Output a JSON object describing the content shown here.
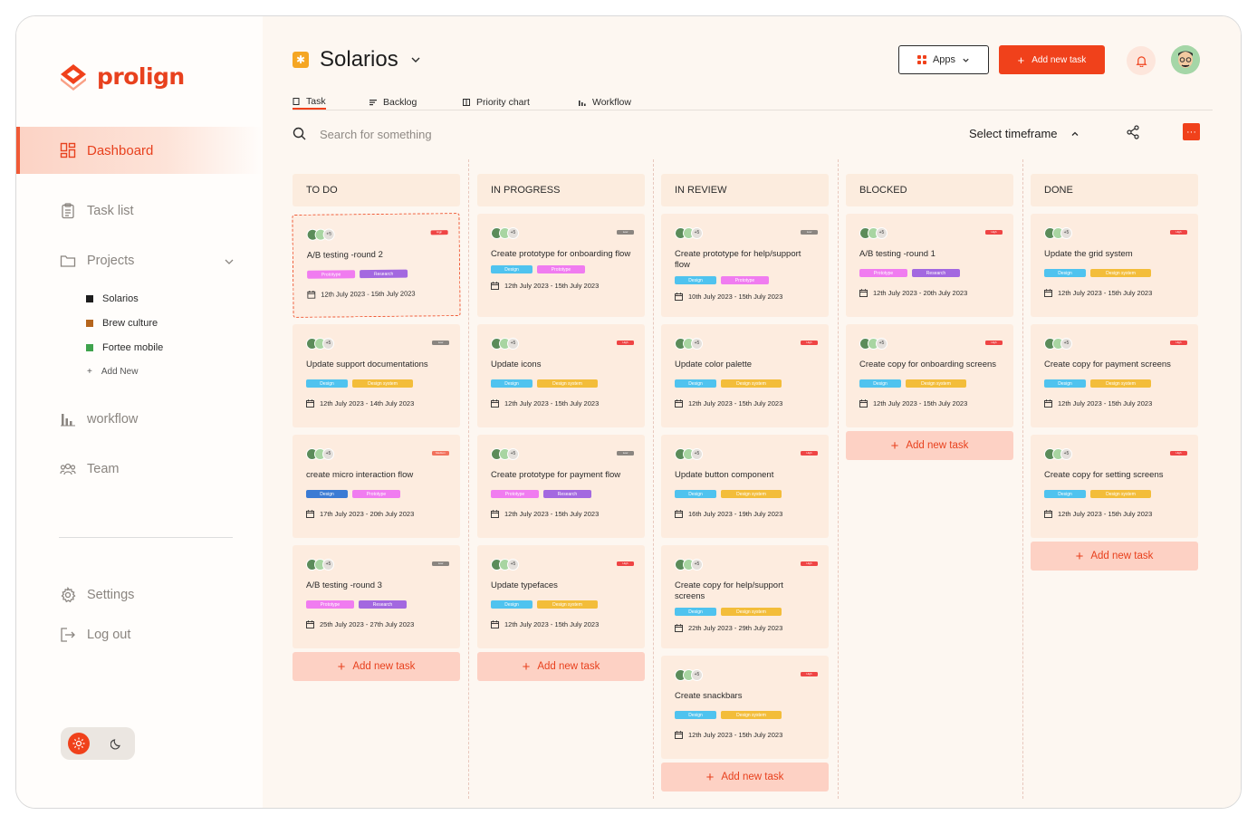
{
  "brand": {
    "name": "prolign",
    "accent": "#F0411B"
  },
  "sidebar": {
    "active_label": "Dashboard",
    "items": [
      {
        "label": "Task list",
        "icon": "clipboard-icon"
      },
      {
        "label": "Projects",
        "icon": "folder-icon"
      },
      {
        "label": "workflow",
        "icon": "bar-chart-icon"
      },
      {
        "label": "Team",
        "icon": "team-icon"
      },
      {
        "label": "Settings",
        "icon": "gear-icon"
      },
      {
        "label": "Log out",
        "icon": "logout-icon"
      }
    ],
    "projects": [
      {
        "name": "Solarios",
        "color": "#1d1d1d"
      },
      {
        "name": "Brew culture",
        "color": "#b5651d"
      },
      {
        "name": "Fortee mobile",
        "color": "#3fa34d"
      }
    ],
    "add_new": "Add New"
  },
  "header": {
    "project": "Solarios",
    "apps_label": "Apps",
    "add_label": "Add new task"
  },
  "tabs": [
    "Task",
    "Backlog",
    "Priority chart",
    "Workflow"
  ],
  "search": {
    "placeholder": "Search for something",
    "timeframe": "Select timeframe",
    "more": "···"
  },
  "add_task_label": "Add new task",
  "avatar_more": "+5",
  "columns": [
    {
      "title": "TO DO",
      "cards": [
        {
          "title": "A/B testing -round 2",
          "priority": "High",
          "tags": [
            "Prototype",
            "Research"
          ],
          "date": "12th July  2023 - 15th July 2023",
          "dragging": true
        },
        {
          "title": "Update support documentations",
          "priority": "Low",
          "tags": [
            "Design",
            "Design system"
          ],
          "date": "12th July  2023 - 14th July 2023"
        },
        {
          "title": "create micro interaction flow",
          "priority": "Medium",
          "tags": [
            "Design",
            "Prototype"
          ],
          "date": "17th July  2023 - 20th July 2023"
        },
        {
          "title": "A/B testing -round 3",
          "priority": "Low",
          "tags": [
            "Prototype",
            "Research"
          ],
          "date": "25th July  2023 - 27th July 2023"
        }
      ]
    },
    {
      "title": "IN PROGRESS",
      "cards": [
        {
          "title": "Create prototype for onboarding flow",
          "priority": "Low",
          "tags": [
            "Design",
            "Prototype"
          ],
          "date": "12th July  2023 - 15th July 2023"
        },
        {
          "title": "Update icons",
          "priority": "High",
          "tags": [
            "Design",
            "Design system"
          ],
          "date": "12th July  2023 - 15th July 2023"
        },
        {
          "title": "Create prototype for payment flow",
          "priority": "Low",
          "tags": [
            "Prototype",
            "Research"
          ],
          "date": "12th July  2023 - 15th July 2023"
        },
        {
          "title": "Update typefaces",
          "priority": "High",
          "tags": [
            "Design",
            "Design system"
          ],
          "date": "12th July  2023 - 15th July 2023"
        }
      ]
    },
    {
      "title": "IN REVIEW",
      "cards": [
        {
          "title": "Create prototype for help/support flow",
          "priority": "Low",
          "tags": [
            "Design",
            "Prototype"
          ],
          "date": "10th July  2023 - 15th July 2023"
        },
        {
          "title": "Update color palette",
          "priority": "High",
          "tags": [
            "Design",
            "Design system"
          ],
          "date": "12th July  2023 - 15th July 2023"
        },
        {
          "title": "Update button component",
          "priority": "High",
          "tags": [
            "Design",
            "Design system"
          ],
          "date": "16th July  2023 - 19th July 2023"
        },
        {
          "title": "Create copy for help/support screens",
          "priority": "High",
          "tags": [
            "Design",
            "Design system"
          ],
          "date": "22th July  2023 - 29th July 2023"
        },
        {
          "title": "Create snackbars",
          "priority": "High",
          "tags": [
            "Design",
            "Design system"
          ],
          "date": "12th July  2023 - 15th July 2023"
        }
      ]
    },
    {
      "title": "BLOCKED",
      "cards": [
        {
          "title": "A/B testing -round 1",
          "priority": "High",
          "tags": [
            "Prototype",
            "Research"
          ],
          "date": "12th July  2023 - 20th July 2023"
        },
        {
          "title": "Create copy for onboarding screens",
          "priority": "High",
          "tags": [
            "Design",
            "Design system"
          ],
          "date": "12th July  2023 - 15th July 2023"
        }
      ]
    },
    {
      "title": "DONE",
      "cards": [
        {
          "title": "Update the grid system",
          "priority": "High",
          "tags": [
            "Design",
            "Design system"
          ],
          "date": "12th July  2023 - 15th July 2023"
        },
        {
          "title": "Create copy for payment screens",
          "priority": "High",
          "tags": [
            "Design",
            "Design system"
          ],
          "date": "12th July  2023 - 15th July 2023"
        },
        {
          "title": "Create copy for setting screens",
          "priority": "High",
          "tags": [
            "Design",
            "Design system"
          ],
          "date": "12th July  2023 - 15th July 2023"
        }
      ]
    }
  ]
}
